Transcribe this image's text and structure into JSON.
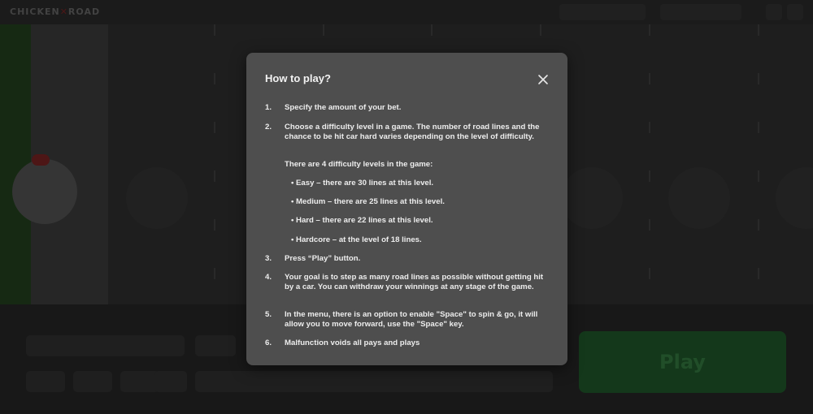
{
  "modal": {
    "title": "How to play?",
    "close_icon": "close-icon",
    "steps": [
      {
        "num": "1.",
        "text": "Specify the amount of your bet."
      },
      {
        "num": "2.",
        "text": "Choose a difficulty level in a game. The number of road lines and the chance to be hit car hard varies depending on the level of difficulty."
      },
      {
        "num": "3.",
        "text": "Press  “Play” button."
      },
      {
        "num": "4.",
        "text": "Your goal is to step as many road lines as possible without getting hit by a car. You can withdraw your winnings at any stage of the game."
      },
      {
        "num": "5.",
        "text": "In the menu, there is an option to enable \"Space\" to spin & go, it will allow you to move forward, use the \"Space\" key."
      },
      {
        "num": "6.",
        "text": "Malfunction voids all pays and plays"
      }
    ],
    "levels_intro": "There are 4 difficulty levels in the game:",
    "levels": [
      "• Easy – there are 30 lines at this level.",
      "• Medium – there are 25 lines at this level.",
      "• Hard – there are 22 lines at this level.",
      "• Hardcore – at the level of 18 lines."
    ]
  },
  "background": {
    "play_label": "Play"
  },
  "colors": {
    "modal_bg": "#4e4e4e",
    "play_button": "#1d4e26",
    "overlay": "rgba(0,0,0,0.28)"
  }
}
